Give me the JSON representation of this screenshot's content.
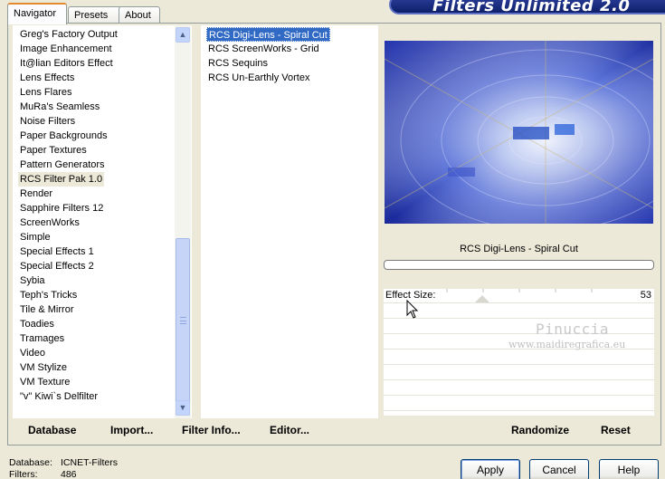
{
  "window": {
    "title": "Filters Unlimited 2.0"
  },
  "tabs": [
    {
      "label": "Navigator",
      "active": true
    },
    {
      "label": "Presets",
      "active": false
    },
    {
      "label": "About",
      "active": false
    }
  ],
  "categories": {
    "items": [
      "Greg's Factory Output",
      "Image Enhancement",
      "It@lian Editors Effect",
      "Lens Effects",
      "Lens Flares",
      "MuRa's Seamless",
      "Noise Filters",
      "Paper Backgrounds",
      "Paper Textures",
      "Pattern Generators",
      "RCS Filter Pak 1.0",
      "Render",
      "Sapphire Filters 12",
      "ScreenWorks",
      "Simple",
      "Special Effects 1",
      "Special Effects 2",
      "Sybia",
      "Teph's Tricks",
      "Tile & Mirror",
      "Toadies",
      "Tramages",
      "Video",
      "VM Stylize",
      "VM Texture",
      "\"v\" Kiwi`s Delfilter"
    ],
    "selected": "RCS Filter Pak 1.0"
  },
  "filters": {
    "items": [
      "RCS Digi-Lens - Spiral Cut",
      "RCS ScreenWorks - Grid",
      "RCS Sequins",
      "RCS Un-Earthly Vortex"
    ],
    "selected": "RCS Digi-Lens - Spiral Cut"
  },
  "preview": {
    "filter_name": "RCS Digi-Lens - Spiral Cut"
  },
  "params": [
    {
      "label": "Effect Size:",
      "value": "53",
      "slider_fraction": 0.21
    }
  ],
  "watermark": {
    "name": "Pinuccia",
    "url": "www.maidiregrafica.eu"
  },
  "bottom_left_buttons": {
    "database": "Database",
    "import": "Import...",
    "filter_info": "Filter Info...",
    "editor": "Editor..."
  },
  "bottom_right_buttons": {
    "randomize": "Randomize",
    "reset": "Reset"
  },
  "status": {
    "database_label": "Database:",
    "database_value": "ICNET-Filters",
    "filters_label": "Filters:",
    "filters_value": "486"
  },
  "dialog_buttons": {
    "apply": "Apply",
    "cancel": "Cancel",
    "help": "Help"
  }
}
